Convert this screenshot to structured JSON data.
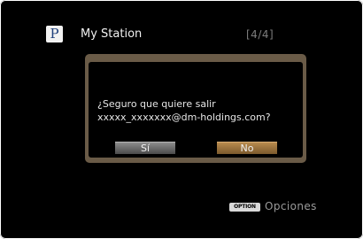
{
  "header": {
    "service_icon_letter": "P",
    "service_icon": "pandora-icon",
    "title": "My Station",
    "page_indicator": "[4/4]"
  },
  "dialog": {
    "message_line1": "¿Seguro que quiere salir",
    "message_line2": "xxxxx_xxxxxxx@dm-holdings.com?",
    "yes_label": "Sí",
    "no_label": "No",
    "selected": "No"
  },
  "footer": {
    "option_key_label": "OPTION",
    "option_label": "Opciones"
  },
  "colors": {
    "background": "#000000",
    "dialog_frame": "#6a5b47",
    "selected_button": "#b98b4e",
    "unselected_button": "#7a7a7a"
  }
}
